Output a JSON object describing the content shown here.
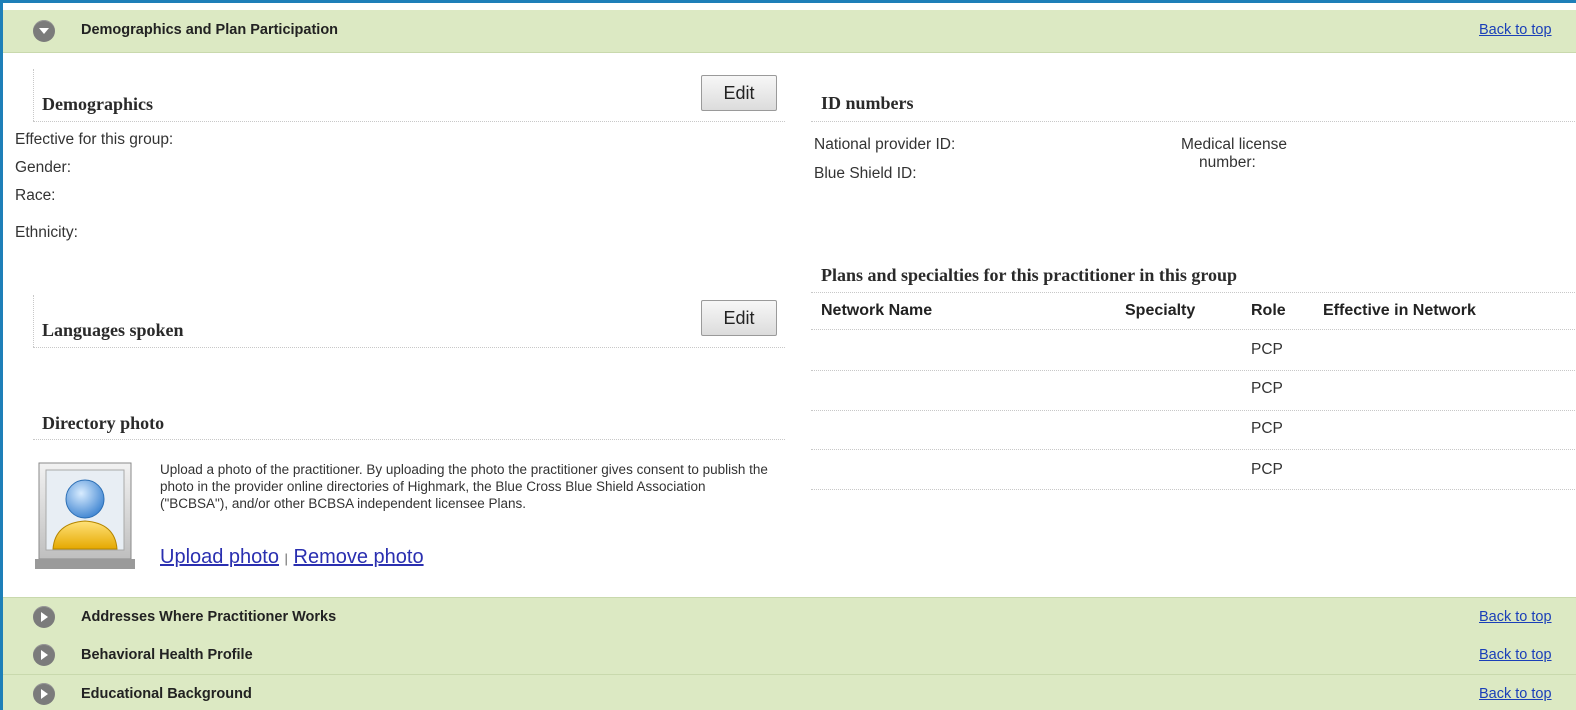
{
  "sections": {
    "demographics_bar": {
      "title": "Demographics and Plan Participation",
      "back_to_top": "Back to top"
    },
    "addresses_bar": {
      "title": "Addresses Where Practitioner Works",
      "back_to_top": "Back to top"
    },
    "behavioral_bar": {
      "title": "Behavioral Health Profile",
      "back_to_top": "Back to top"
    },
    "education_bar": {
      "title": "Educational Background",
      "back_to_top": "Back to top"
    }
  },
  "demographics": {
    "heading": "Demographics",
    "edit_label": "Edit",
    "fields": [
      "Effective for this group:",
      "Gender:",
      "Race:",
      "Ethnicity:"
    ]
  },
  "languages": {
    "heading": "Languages spoken",
    "edit_label": "Edit"
  },
  "directory_photo": {
    "heading": "Directory photo",
    "description": "Upload a photo of the practitioner. By uploading the photo the practitioner gives consent to publish the photo in the provider online directories of Highmark, the Blue Cross Blue Shield Association (\"BCBSA\"), and/or other BCBSA independent licensee Plans.",
    "upload_label": "Upload photo",
    "separator": "|",
    "remove_label": "Remove photo",
    "avatar_icon": "user-avatar-icon"
  },
  "id_numbers": {
    "heading": "ID numbers",
    "npi_label": "National provider ID:",
    "blue_shield_label": "Blue Shield ID:",
    "medical_license_line1": "Medical license",
    "medical_license_line2": "number:"
  },
  "plans": {
    "heading": "Plans and specialties for this practitioner in this group",
    "columns": {
      "network": "Network Name",
      "specialty": "Specialty",
      "role": "Role",
      "effective": "Effective in Network"
    },
    "rows": [
      {
        "network": "",
        "specialty": "",
        "role": "PCP",
        "effective": ""
      },
      {
        "network": "",
        "specialty": "",
        "role": "PCP",
        "effective": ""
      },
      {
        "network": "",
        "specialty": "",
        "role": "PCP",
        "effective": ""
      },
      {
        "network": "",
        "specialty": "",
        "role": "PCP",
        "effective": ""
      }
    ]
  },
  "colors": {
    "bar_green": "#dce9c3",
    "frame_blue": "#1e7fb8",
    "link_blue": "#2a2fb0"
  }
}
